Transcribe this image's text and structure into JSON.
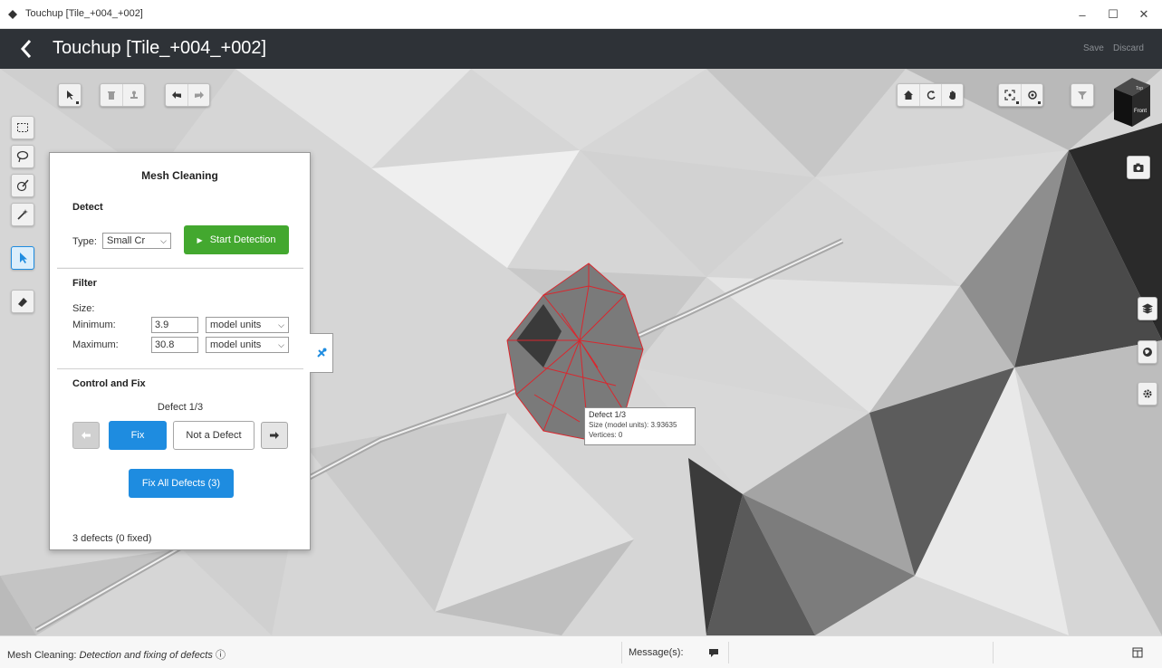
{
  "os_window": {
    "title": "Touchup [Tile_+004_+002]",
    "minimize": "–",
    "maximize": "☐",
    "close": "✕"
  },
  "header": {
    "title": "Touchup [Tile_+004_+002]",
    "save_label": "Save",
    "discard_label": "Discard"
  },
  "toolbar_top_left": {
    "buttons": [
      "select-tool",
      "delete",
      "clean",
      "undo",
      "redo"
    ]
  },
  "toolbar_top_right": {
    "buttons": [
      "home-view",
      "rotate",
      "pan",
      "zoom-extents",
      "visibility",
      "filter"
    ]
  },
  "nav_cube": {
    "top_face": "Top",
    "front_face": "Front"
  },
  "left_tools": [
    "rectangle-select",
    "lasso-select",
    "brush-select",
    "magic-wand",
    "mesh-cleaning",
    "eraser"
  ],
  "right_tools": [
    "camera",
    "layers",
    "globe",
    "settings"
  ],
  "mesh_cleaning": {
    "title": "Mesh Cleaning",
    "detect": {
      "section_title": "Detect",
      "type_label": "Type:",
      "type_value": "Small Cr",
      "start_button": "Start Detection"
    },
    "filter": {
      "section_title": "Filter",
      "size_label": "Size:",
      "min_label": "Minimum:",
      "min_value": "3.9",
      "min_unit": "model units",
      "max_label": "Maximum:",
      "max_value": "30.8",
      "max_unit": "model units"
    },
    "control": {
      "section_title": "Control and Fix",
      "defect_counter": "Defect 1/3",
      "fix_label": "Fix",
      "not_defect_label": "Not a Defect",
      "fix_all_label": "Fix All Defects (3)"
    },
    "summary": "3 defects (0 fixed)"
  },
  "tooltip": {
    "title": "Defect 1/3",
    "size_line": "Size (model units): 3.93635",
    "vertices_line": "Vertices: 0"
  },
  "statusbar": {
    "mode": "Mesh Cleaning:",
    "description": "Detection and fixing of defects",
    "info_icon": "ⓘ",
    "messages_label": "Message(s):"
  }
}
